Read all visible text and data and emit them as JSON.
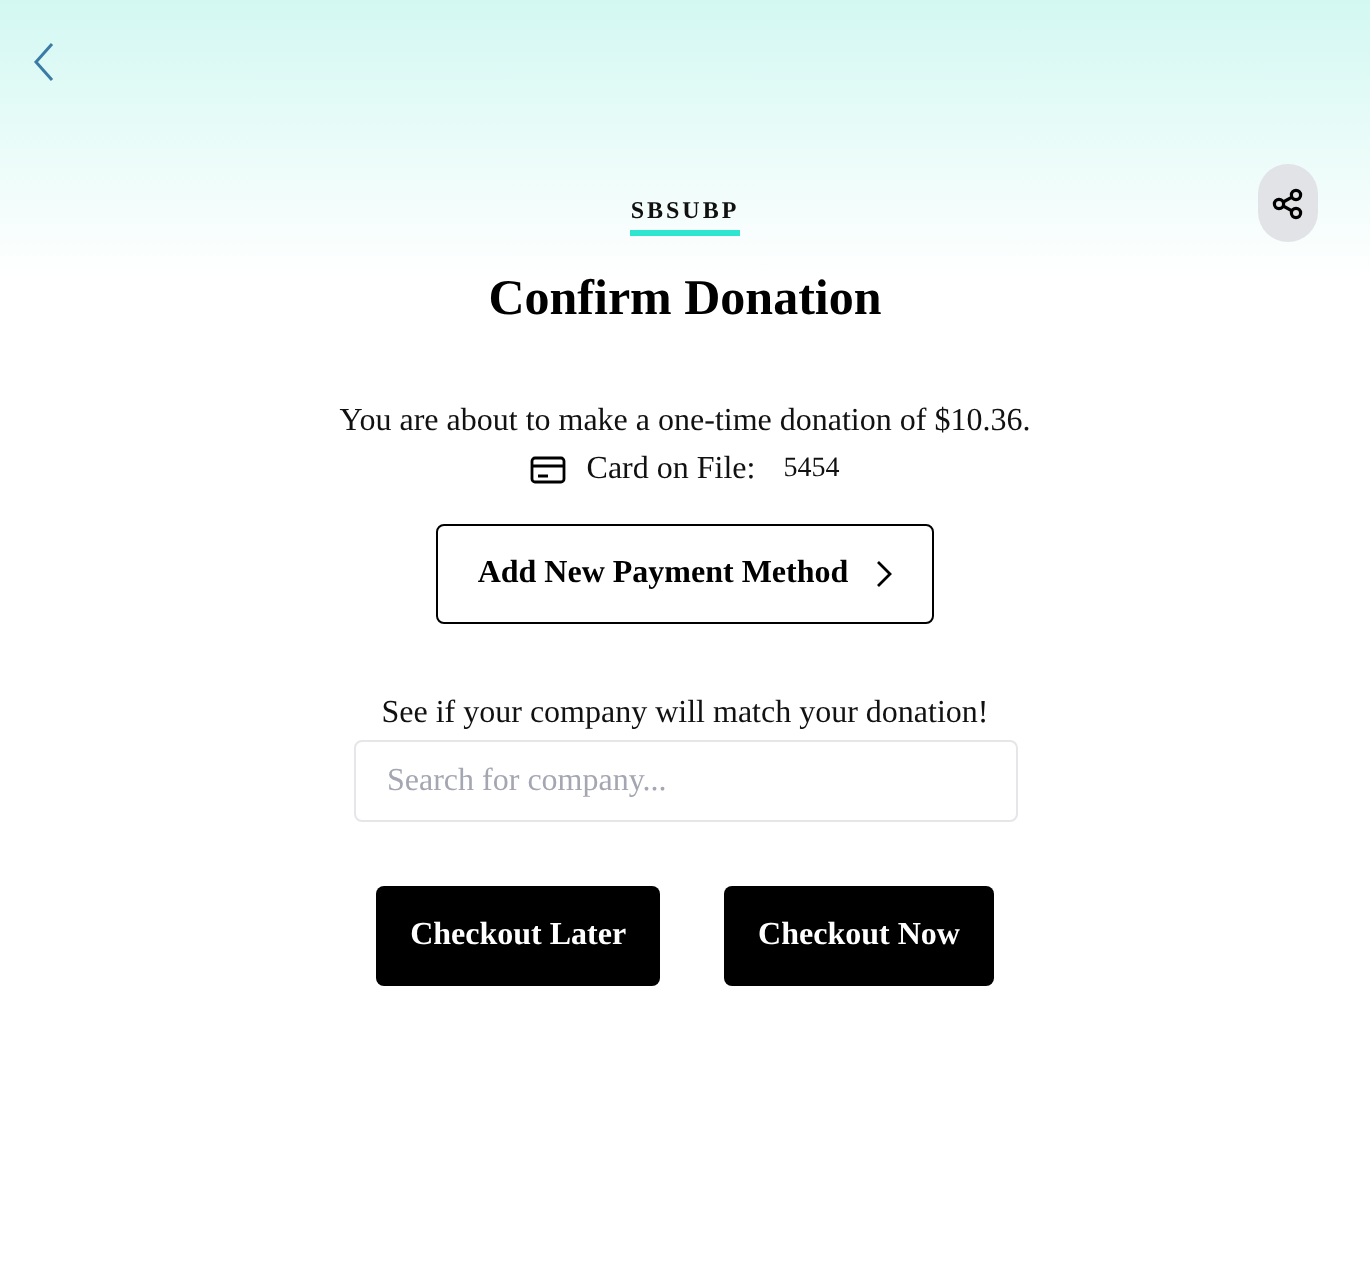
{
  "header": {
    "org_code": "SBSUBP"
  },
  "title": "Confirm Donation",
  "summary": "You are about to make a one-time donation of $10.36.",
  "card": {
    "label": "Card on File:",
    "last_digits": "5454"
  },
  "add_payment_button": "Add New Payment Method",
  "match_prompt": "See if your company will match your donation!",
  "company_search": {
    "placeholder": "Search for company..."
  },
  "buttons": [
    "Checkout Later",
    "Checkout Now"
  ]
}
